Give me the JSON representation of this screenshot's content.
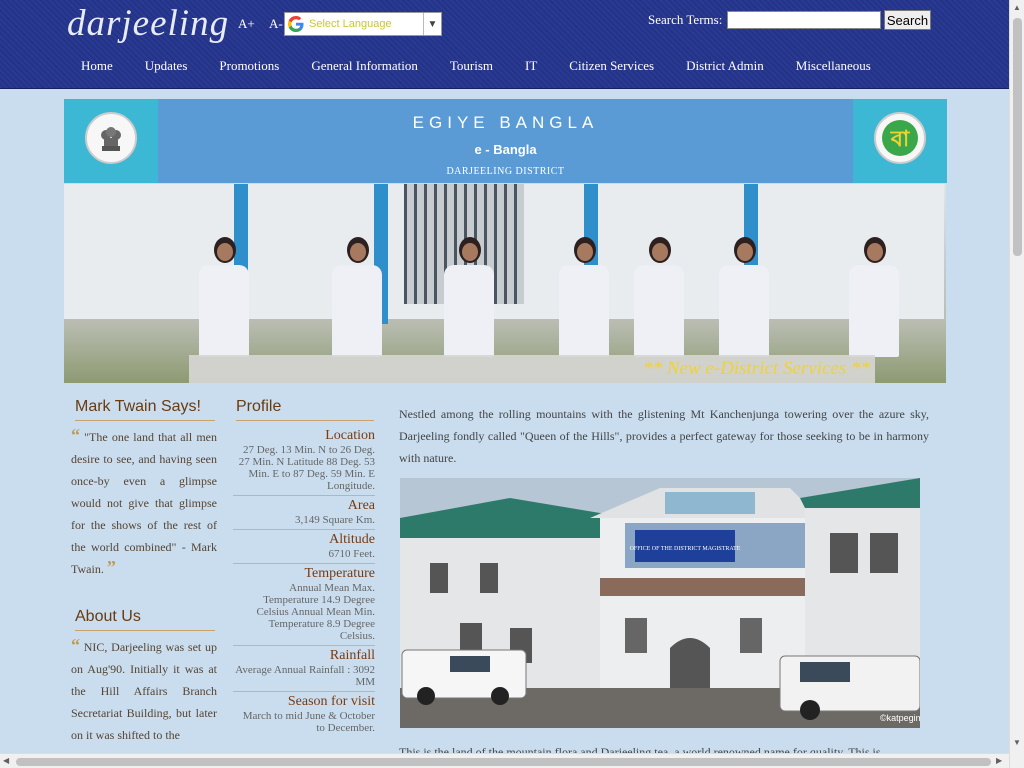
{
  "header": {
    "logo": "darjeeling",
    "font_increase": "A+",
    "font_decrease": "A-",
    "translate_label": "Select Language",
    "search_label": "Search Terms:",
    "search_value": "",
    "search_button": "Search"
  },
  "nav": [
    "Home",
    "Updates",
    "Promotions",
    "General Information",
    "Tourism",
    "IT",
    "Citizen Services",
    "District Admin",
    "Miscellaneous"
  ],
  "banner": {
    "title": "EGIYE BANGLA",
    "subtitle": "e - Bangla",
    "district": "DARJEELING DISTRICT",
    "caption": "** New e-District Services **"
  },
  "mark_twain": {
    "title": "Mark Twain Says!",
    "quote": "\"The one land that all men desire to see, and having seen once-by even a glimpse would not give that glimpse for the shows of the rest of the world combined\" - Mark Twain."
  },
  "about": {
    "title": "About Us",
    "text": "NIC, Darjeeling was set up on Aug'90. Initially it was at the Hill Affairs Branch Secretariat Building, but later on it was shifted to the"
  },
  "profile": {
    "title": "Profile",
    "items": [
      {
        "heading": "Location",
        "value": "27 Deg. 13 Min. N to 26 Deg. 27 Min. N Latitude 88 Deg. 53 Min. E to 87 Deg. 59 Min. E Longitude."
      },
      {
        "heading": "Area",
        "value": "3,149 Square Km."
      },
      {
        "heading": "Altitude",
        "value": "6710 Feet."
      },
      {
        "heading": "Temperature",
        "value": "Annual Mean Max. Temperature 14.9 Degree Celsius Annual Mean Min. Temperature 8.9 Degree Celsius."
      },
      {
        "heading": "Rainfall",
        "value": "Average Annual Rainfall : 3092 MM"
      },
      {
        "heading": "Season for visit",
        "value": "March to mid June & October to December."
      }
    ]
  },
  "main": {
    "intro": "Nestled among the rolling mountains with the glistening Mt Kanchenjunga towering over the azure sky, Darjeeling fondly called \"Queen of the Hills\", provides a perfect gateway for those seeking to be in harmony with nature.",
    "photo_watermark": "©katpegimana",
    "sign_text": "OFFICE OF THE DISTRICT MAGISTRATE",
    "bottom": "This is the land of the mountain flora and Darjeeling tea, a world renowned name for quality. This is"
  }
}
